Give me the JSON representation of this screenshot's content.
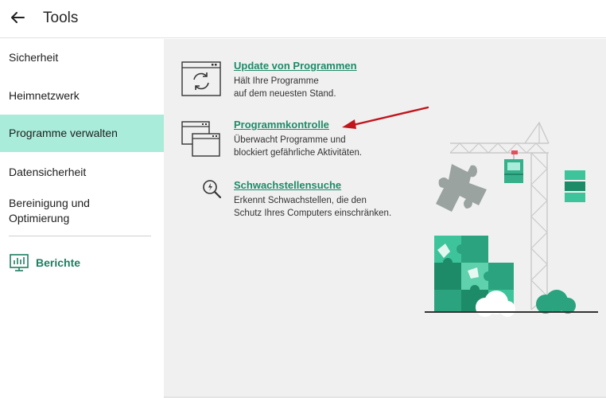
{
  "header": {
    "title": "Tools"
  },
  "sidebar": {
    "items": [
      {
        "label": "Sicherheit"
      },
      {
        "label": "Heimnetzwerk"
      },
      {
        "label": "Programme verwalten"
      },
      {
        "label": "Datensicherheit"
      },
      {
        "label": "Bereinigung und"
      },
      {
        "label": "Optimierung"
      }
    ],
    "reports_label": "Berichte"
  },
  "tools": [
    {
      "title": "Update von Programmen",
      "desc_line1": "Hält Ihre Programme",
      "desc_line2": "auf dem neuesten Stand."
    },
    {
      "title": "Programmkontrolle",
      "desc_line1": "Überwacht Programme und",
      "desc_line2": "blockiert gefährliche Aktivitäten."
    },
    {
      "title": "Schwachstellensuche",
      "desc_line1": "Erkennt Schwachstellen, die den",
      "desc_line2": "Schutz Ihres Computers einschränken."
    }
  ],
  "colors": {
    "accent": "#1d8a68",
    "active_nav": "#a9ecd9",
    "annotation_arrow": "#c0151b"
  }
}
